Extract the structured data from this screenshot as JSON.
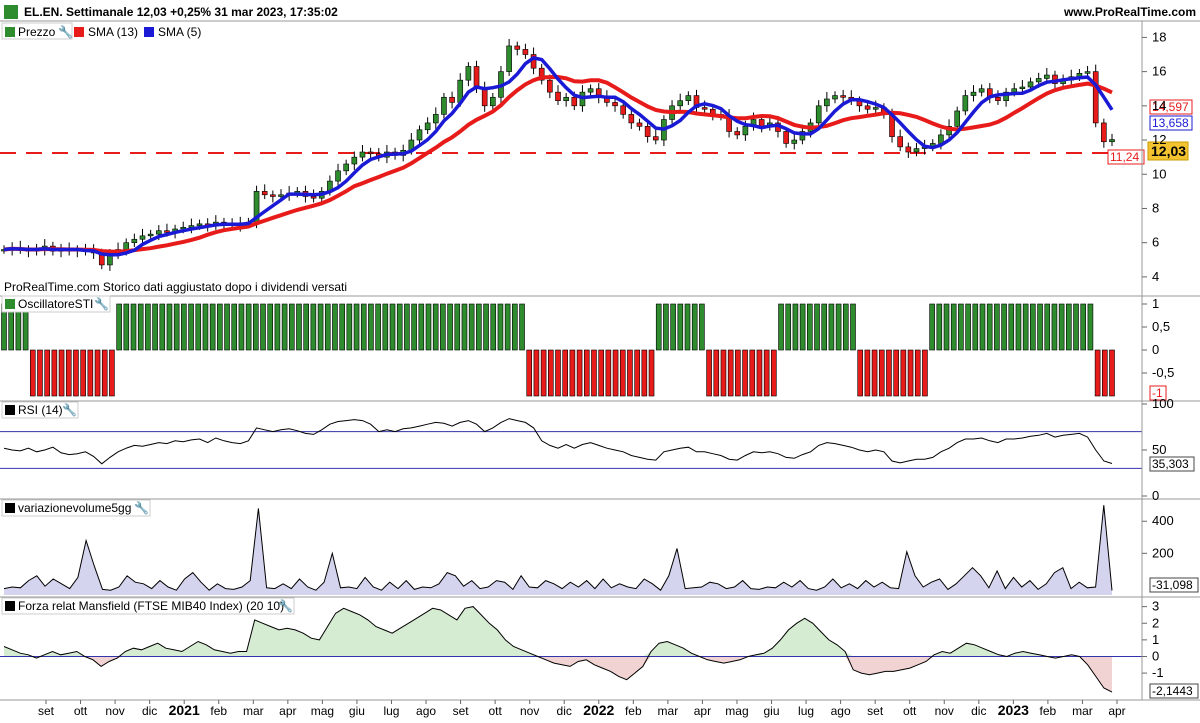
{
  "header": {
    "title": "EL.EN. Settimanale 12,03 +0,25% 31 mar 2023, 17:35:02",
    "site": "www.ProRealTime.com"
  },
  "panels": {
    "price": {
      "legend": [
        {
          "label": "Prezzo",
          "color": "#2e8b2e"
        },
        {
          "label": "SMA (13)",
          "color": "#e81b1b"
        },
        {
          "label": "SMA (5)",
          "color": "#1a1ad6"
        }
      ],
      "note": "ProRealTime.com  Storico dati aggiustato dopo i dividendi versati",
      "last_close_label": "12,03",
      "sma13_label": "14,597",
      "sma5_label": "13,658",
      "support_label": "11,24",
      "y_ticks": [
        "18",
        "16",
        "14",
        "12",
        "10",
        "8",
        "6",
        "4"
      ]
    },
    "sti": {
      "label": "OscillatoreSTI",
      "y_ticks": [
        "1",
        "0,5",
        "0",
        "-0,5"
      ],
      "last_label": "-1"
    },
    "rsi": {
      "label": "RSI (14)",
      "y_ticks": [
        "100",
        "50",
        "0"
      ],
      "last_label": "35,303"
    },
    "volume": {
      "label": "variazionevolume5gg",
      "y_ticks": [
        "400",
        "200"
      ],
      "last_label": "-31,098"
    },
    "mansfield": {
      "label": "Forza relat Mansfield (FTSE MIB40 Index) (20 10)",
      "y_ticks": [
        "3",
        "2",
        "1",
        "0",
        "-1"
      ],
      "last_label": "-2,1443"
    }
  },
  "x_axis": [
    {
      "label": "set",
      "bold": false
    },
    {
      "label": "ott",
      "bold": false
    },
    {
      "label": "nov",
      "bold": false
    },
    {
      "label": "dic",
      "bold": false
    },
    {
      "label": "2021",
      "bold": true
    },
    {
      "label": "feb",
      "bold": false
    },
    {
      "label": "mar",
      "bold": false
    },
    {
      "label": "apr",
      "bold": false
    },
    {
      "label": "mag",
      "bold": false
    },
    {
      "label": "giu",
      "bold": false
    },
    {
      "label": "lug",
      "bold": false
    },
    {
      "label": "ago",
      "bold": false
    },
    {
      "label": "set",
      "bold": false
    },
    {
      "label": "ott",
      "bold": false
    },
    {
      "label": "nov",
      "bold": false
    },
    {
      "label": "dic",
      "bold": false
    },
    {
      "label": "2022",
      "bold": true
    },
    {
      "label": "feb",
      "bold": false
    },
    {
      "label": "mar",
      "bold": false
    },
    {
      "label": "apr",
      "bold": false
    },
    {
      "label": "mag",
      "bold": false
    },
    {
      "label": "giu",
      "bold": false
    },
    {
      "label": "lug",
      "bold": false
    },
    {
      "label": "ago",
      "bold": false
    },
    {
      "label": "set",
      "bold": false
    },
    {
      "label": "ott",
      "bold": false
    },
    {
      "label": "nov",
      "bold": false
    },
    {
      "label": "dic",
      "bold": false
    },
    {
      "label": "2023",
      "bold": true
    },
    {
      "label": "feb",
      "bold": false
    },
    {
      "label": "mar",
      "bold": false
    },
    {
      "label": "apr",
      "bold": false
    }
  ],
  "chart_data": {
    "type": "line",
    "title": "EL.EN. Settimanale 12,03 +0,25% 31 mar 2023, 17:35:02",
    "period": "weekly",
    "x_start": "2020-08",
    "x_end": "2023-03",
    "price_scale": [
      4,
      18
    ],
    "support_level": 11.24,
    "last_close": 12.03,
    "price_close": [
      5.6,
      5.7,
      5.6,
      5.5,
      5.6,
      5.8,
      5.5,
      5.6,
      5.5,
      5.6,
      5.5,
      5.4,
      4.7,
      5.3,
      5.6,
      6.0,
      6.2,
      6.4,
      6.5,
      6.7,
      6.6,
      6.8,
      6.9,
      7.0,
      7.1,
      7.0,
      7.2,
      7.1,
      7.0,
      7.1,
      7.2,
      9.0,
      8.8,
      8.7,
      8.8,
      8.9,
      9.0,
      8.7,
      8.6,
      9.0,
      9.6,
      10.2,
      10.6,
      11.0,
      11.3,
      11.2,
      11.0,
      11.3,
      11.1,
      11.4,
      12.0,
      12.6,
      13.0,
      13.5,
      14.5,
      14.2,
      15.5,
      16.3,
      15.0,
      14.0,
      14.5,
      16.0,
      17.5,
      17.3,
      17.0,
      16.2,
      15.5,
      14.8,
      14.3,
      14.5,
      14.0,
      14.8,
      15.0,
      14.5,
      14.2,
      14.0,
      13.5,
      13.0,
      12.8,
      12.2,
      12.0,
      13.2,
      14.0,
      14.3,
      14.6,
      13.9,
      13.8,
      13.5,
      13.4,
      12.5,
      12.3,
      12.8,
      13.2,
      12.8,
      13.0,
      12.5,
      11.8,
      12.0,
      12.5,
      13.0,
      14.0,
      14.4,
      14.6,
      14.5,
      14.3,
      14.0,
      13.8,
      13.9,
      13.5,
      12.2,
      11.6,
      11.3,
      11.5,
      11.6,
      11.8,
      12.3,
      12.8,
      13.7,
      14.6,
      14.8,
      15.0,
      14.5,
      14.3,
      14.8,
      15.0,
      15.1,
      15.4,
      15.6,
      15.8,
      15.3,
      15.5,
      15.7,
      15.9,
      16.0,
      13.0,
      11.9,
      12.03
    ],
    "sma13_last": 14.597,
    "sma5_last": 13.658,
    "sti_values": [
      1,
      1,
      1,
      1,
      -1,
      -1,
      -1,
      -1,
      -1,
      -1,
      -1,
      -1,
      -1,
      -1,
      -1,
      -1,
      1,
      1,
      1,
      1,
      1,
      1,
      1,
      1,
      1,
      1,
      1,
      1,
      1,
      1,
      1,
      1,
      1,
      1,
      1,
      1,
      1,
      1,
      1,
      1,
      1,
      1,
      1,
      1,
      1,
      1,
      1,
      1,
      1,
      1,
      1,
      1,
      1,
      1,
      1,
      1,
      1,
      1,
      1,
      1,
      1,
      1,
      1,
      1,
      1,
      1,
      1,
      1,
      1,
      1,
      1,
      1,
      1,
      -1,
      -1,
      -1,
      -1,
      -1,
      -1,
      -1,
      -1,
      -1,
      -1,
      -1,
      -1,
      -1,
      -1,
      -1,
      -1,
      -1,
      -1,
      1,
      1,
      1,
      1,
      1,
      1,
      1,
      -1,
      -1,
      -1,
      -1,
      -1,
      -1,
      -1,
      -1,
      -1,
      -1,
      1,
      1,
      1,
      1,
      1,
      1,
      1,
      1,
      1,
      1,
      1,
      -1,
      -1,
      -1,
      -1,
      -1,
      -1,
      -1,
      -1,
      -1,
      -1,
      1,
      1,
      1,
      1,
      1,
      1,
      1,
      1,
      1,
      1,
      1,
      1,
      1,
      1,
      1,
      1,
      1,
      1,
      1,
      1,
      1,
      1,
      1,
      -1,
      -1,
      -1
    ],
    "rsi_levels": [
      70,
      30
    ],
    "rsi_last": 35.303,
    "rsi_values": [
      52,
      50,
      49,
      52,
      48,
      50,
      53,
      47,
      45,
      46,
      48,
      43,
      35,
      42,
      48,
      52,
      55,
      54,
      56,
      58,
      57,
      60,
      59,
      61,
      62,
      58,
      63,
      60,
      58,
      57,
      60,
      74,
      72,
      70,
      72,
      73,
      71,
      68,
      67,
      72,
      78,
      81,
      82,
      83,
      82,
      78,
      70,
      72,
      70,
      73,
      74,
      76,
      78,
      80,
      79,
      76,
      80,
      82,
      78,
      70,
      74,
      80,
      84,
      82,
      80,
      74,
      60,
      55,
      52,
      56,
      52,
      56,
      58,
      55,
      52,
      50,
      48,
      44,
      42,
      40,
      39,
      48,
      50,
      52,
      53,
      48,
      48,
      46,
      44,
      40,
      39,
      44,
      48,
      47,
      48,
      46,
      42,
      41,
      45,
      48,
      55,
      58,
      57,
      55,
      53,
      50,
      48,
      50,
      48,
      38,
      36,
      38,
      40,
      40,
      42,
      48,
      52,
      58,
      62,
      62,
      63,
      60,
      58,
      62,
      62,
      63,
      65,
      66,
      68,
      64,
      66,
      67,
      68,
      64,
      50,
      38,
      35.303
    ],
    "volume_last": -31.098,
    "volume_values": [
      -20,
      -10,
      -15,
      30,
      60,
      -5,
      40,
      10,
      -20,
      50,
      280,
      120,
      -25,
      -30,
      -10,
      60,
      20,
      10,
      -20,
      30,
      -10,
      -30,
      40,
      80,
      20,
      -30,
      10,
      -20,
      -25,
      -10,
      30,
      480,
      -15,
      -20,
      10,
      -20,
      40,
      -10,
      -30,
      20,
      200,
      -15,
      -10,
      -20,
      50,
      -10,
      -30,
      20,
      -20,
      30,
      -25,
      -10,
      -15,
      10,
      80,
      60,
      -5,
      30,
      -20,
      -10,
      30,
      20,
      -25,
      60,
      -10,
      -15,
      30,
      10,
      -20,
      20,
      -10,
      30,
      -20,
      40,
      -15,
      10,
      -10,
      -20,
      40,
      10,
      -30,
      60,
      230,
      -20,
      -15,
      -10,
      20,
      10,
      -20,
      -10,
      30,
      -20,
      -25,
      -10,
      -15,
      20,
      -10,
      30,
      -20,
      -30,
      -10,
      40,
      -15,
      10,
      -20,
      30,
      -10,
      20,
      -15,
      -20,
      210,
      60,
      -10,
      20,
      40,
      -25,
      10,
      60,
      110,
      60,
      -15,
      90,
      -20,
      50,
      -10,
      30,
      -25,
      10,
      80,
      110,
      -20,
      20,
      -15,
      -10,
      500,
      -31.098
    ],
    "mansfield_last": -2.1443,
    "mansfield_values": [
      0.6,
      0.4,
      0.2,
      0.1,
      -0.1,
      0.1,
      0.3,
      0.1,
      0.2,
      0.3,
      0.0,
      -0.2,
      -0.6,
      -0.3,
      -0.1,
      0.3,
      0.5,
      0.4,
      0.6,
      0.8,
      0.5,
      0.4,
      0.3,
      0.6,
      0.9,
      0.7,
      0.4,
      0.3,
      0.2,
      0.3,
      0.3,
      2.2,
      2.0,
      1.8,
      1.6,
      1.7,
      1.6,
      1.4,
      1.1,
      1.0,
      1.8,
      2.6,
      2.9,
      2.7,
      2.5,
      2.2,
      1.8,
      1.6,
      1.4,
      1.7,
      2.0,
      2.3,
      2.6,
      2.9,
      2.8,
      2.5,
      2.2,
      2.9,
      3.0,
      2.5,
      2.0,
      1.6,
      1.0,
      0.6,
      0.4,
      0.2,
      0.0,
      -0.2,
      -0.4,
      -0.5,
      -0.6,
      -0.3,
      -0.2,
      -0.5,
      -0.7,
      -0.9,
      -1.2,
      -1.4,
      -1.0,
      -0.6,
      0.3,
      0.8,
      0.9,
      0.7,
      0.5,
      0.2,
      0.0,
      -0.2,
      -0.3,
      -0.4,
      -0.3,
      -0.2,
      0.0,
      0.1,
      0.2,
      0.5,
      1.0,
      1.6,
      2.0,
      2.3,
      2.0,
      1.5,
      1.0,
      0.7,
      0.3,
      -0.8,
      -1.0,
      -1.1,
      -1.0,
      -0.9,
      -0.9,
      -0.8,
      -0.7,
      -0.5,
      -0.3,
      0.1,
      0.3,
      0.2,
      0.5,
      0.8,
      0.7,
      0.5,
      0.3,
      0.1,
      0.0,
      0.2,
      0.3,
      0.2,
      0.1,
      0.0,
      -0.1,
      0.0,
      0.1,
      0.0,
      -0.5,
      -1.2,
      -1.9,
      -2.1443
    ]
  }
}
